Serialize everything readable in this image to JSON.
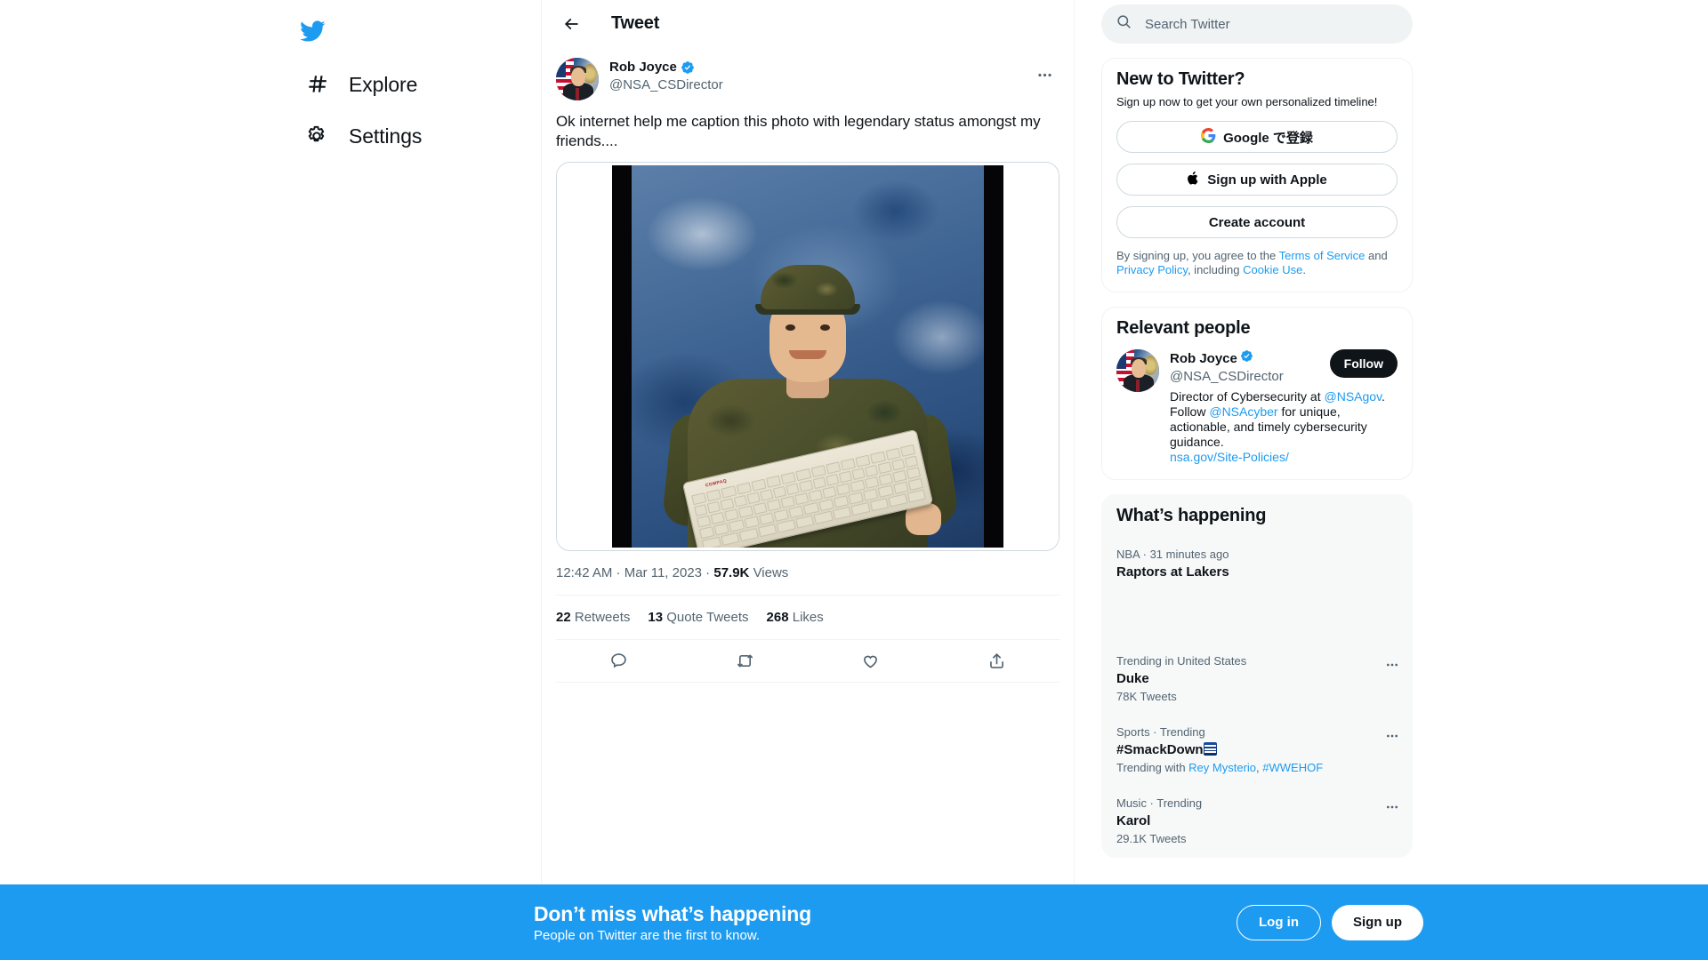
{
  "sidebar": {
    "logo": "twitter-bird-logo",
    "items": [
      {
        "icon": "hashtag-icon",
        "label": "Explore"
      },
      {
        "icon": "gear-icon",
        "label": "Settings"
      }
    ]
  },
  "header": {
    "back": "back-arrow",
    "title": "Tweet"
  },
  "tweet": {
    "author": {
      "name": "Rob Joyce",
      "handle": "@NSA_CSDirector",
      "verified": true
    },
    "text": "Ok internet help me caption this photo with legendary status amongst my friends....",
    "media": {
      "alt": "Young soldier in woodland camouflage uniform holding a beige Compaq keyboard in a studio portrait with a blue mottled backdrop",
      "keyboard_brand": "COMPAQ"
    },
    "meta": {
      "time": "12:42 AM",
      "separator1": " · ",
      "date": "Mar 11, 2023",
      "separator2": " · ",
      "views_count": "57.9K",
      "views_label": "Views"
    },
    "stats": [
      {
        "count": "22",
        "label": "Retweets"
      },
      {
        "count": "13",
        "label": "Quote Tweets"
      },
      {
        "count": "268",
        "label": "Likes"
      }
    ],
    "actions": [
      {
        "name": "reply-icon"
      },
      {
        "name": "retweet-icon"
      },
      {
        "name": "like-icon"
      },
      {
        "name": "share-icon"
      }
    ]
  },
  "search": {
    "placeholder": "Search Twitter",
    "value": ""
  },
  "signup_card": {
    "title": "New to Twitter?",
    "subtitle": "Sign up now to get your own personalized timeline!",
    "google_button": "Google で登録",
    "apple_button": "Sign up with Apple",
    "create_button": "Create account",
    "legal": {
      "part1": "By signing up, you agree to the ",
      "terms": "Terms of Service",
      "part2": " and ",
      "privacy": "Privacy Policy",
      "part3": ", including ",
      "cookie": "Cookie Use",
      "part4": "."
    }
  },
  "relevant_people": {
    "title": "Relevant people",
    "person": {
      "name": "Rob Joyce",
      "handle": "@NSA_CSDirector",
      "follow_label": "Follow",
      "bio_part1": "Director of Cybersecurity at ",
      "bio_link1": "@NSAgov",
      "bio_part2": ". Follow ",
      "bio_link2": "@NSAcyber",
      "bio_part3": " for unique, actionable, and timely cybersecurity guidance.",
      "site": "nsa.gov/Site-Policies/"
    }
  },
  "whats_happening": {
    "title": "What’s happening",
    "items": [
      {
        "category": "NBA · 31 minutes ago",
        "name": "Raptors at Lakers",
        "count": "",
        "trending_with_prefix": "",
        "has_dots": false,
        "is_live": true
      },
      {
        "category": "Trending in United States",
        "name": "Duke",
        "count": "78K Tweets",
        "trending_with_prefix": "",
        "has_dots": true,
        "is_live": false
      },
      {
        "category": "Sports · Trending",
        "name": "#SmackDown",
        "count": "",
        "trending_with_prefix": "Trending with ",
        "trending_with_link1": "Rey Mysterio",
        "trending_with_sep": ", ",
        "trending_with_link2": "#WWEHOF",
        "has_dots": true,
        "is_live": false,
        "has_emoji": true
      },
      {
        "category": "Music · Trending",
        "name": "Karol",
        "count": "29.1K Tweets",
        "trending_with_prefix": "",
        "has_dots": true,
        "is_live": false
      }
    ]
  },
  "bottom_bar": {
    "title": "Don’t miss what’s happening",
    "subtitle": "People on Twitter are the first to know.",
    "login_label": "Log in",
    "signup_label": "Sign up"
  },
  "colors": {
    "brand_blue": "#1d9bf0",
    "text_primary": "#0f1419",
    "text_secondary": "#536471",
    "border": "#eff3f4",
    "gray_bg": "#f7f9f9"
  }
}
